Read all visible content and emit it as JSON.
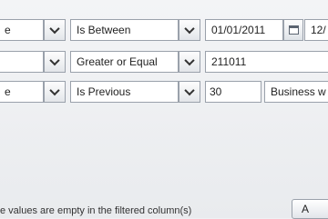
{
  "rows": [
    {
      "column_value": "e",
      "operator": "Is Between",
      "value1": "01/01/2011",
      "value2": "12/"
    },
    {
      "column_value": "",
      "operator": "Greater or Equal",
      "value1": "211011"
    },
    {
      "column_value": "e",
      "operator": "Is Previous",
      "value1": "30",
      "unit": "Business w"
    }
  ],
  "footer": {
    "hint": "e values are empty in the filtered column(s)",
    "button_label": "A"
  },
  "icons": {
    "dropdown": "chevron-down-icon",
    "calendar": "calendar-icon"
  }
}
